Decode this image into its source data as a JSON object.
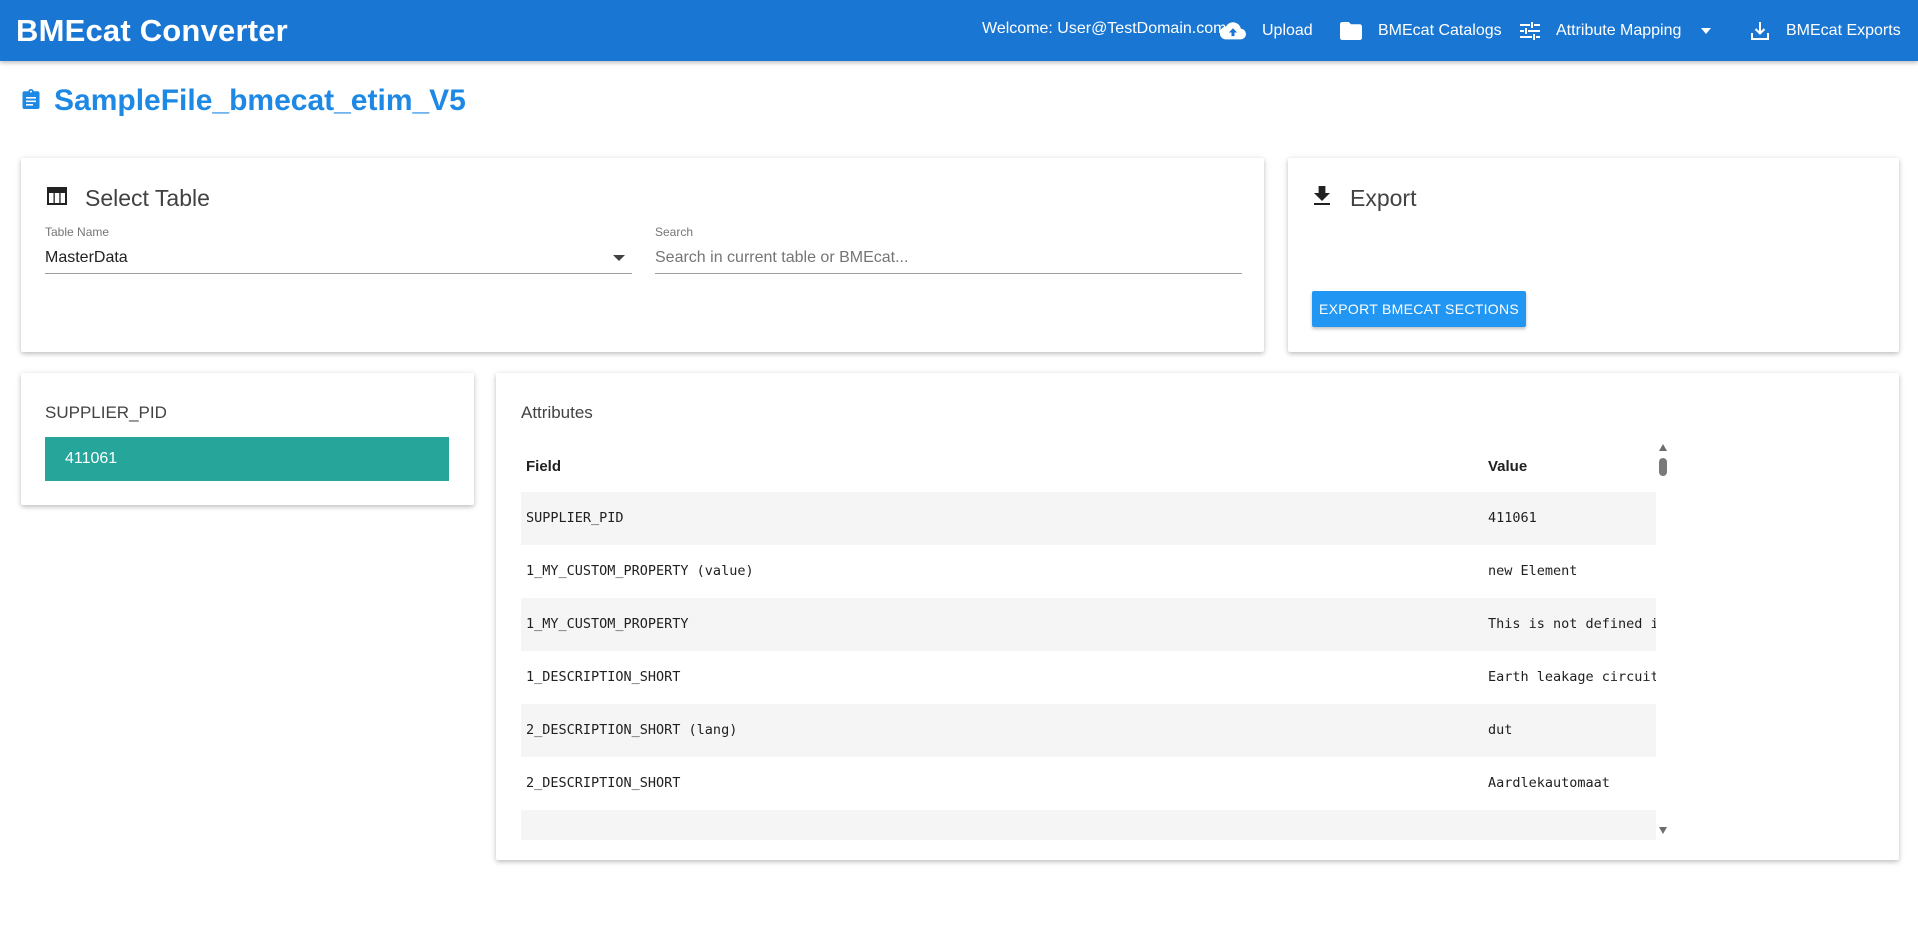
{
  "app": {
    "title": "BMEcat Converter",
    "accent": "#1976d2"
  },
  "header": {
    "welcome": "Welcome: User@TestDomain.com",
    "nav": {
      "upload": {
        "label": "Upload",
        "icon": "cloud-upload-icon"
      },
      "catalogs": {
        "label": "BMEcat Catalogs",
        "icon": "folder-icon"
      },
      "mapping": {
        "label": "Attribute Mapping",
        "icon": "tune-icon"
      },
      "exports": {
        "label": "BMEcat Exports",
        "icon": "download-tray-icon"
      }
    }
  },
  "page": {
    "title": "SampleFile_bmecat_etim_V5",
    "title_icon": "clipboard-icon",
    "title_color": "#1e88e5"
  },
  "select_table": {
    "heading": "Select Table",
    "icon": "table-icon",
    "table_name_label": "Table Name",
    "table_name_value": "MasterData",
    "search_label": "Search",
    "search_placeholder": "Search in current table or BMEcat..."
  },
  "export": {
    "heading": "Export",
    "icon": "download-icon",
    "button_label": "EXPORT BMECAT SECTIONS",
    "button_color": "#2196f3"
  },
  "supplier": {
    "heading": "SUPPLIER_PID",
    "selected": "411061",
    "selected_color": "#26a69a"
  },
  "attributes": {
    "heading": "Attributes",
    "columns": {
      "field": "Field",
      "value": "Value"
    },
    "rows": [
      {
        "field": "SUPPLIER_PID",
        "value": "411061"
      },
      {
        "field": "1_MY_CUSTOM_PROPERTY (value)",
        "value": "new Element"
      },
      {
        "field": "1_MY_CUSTOM_PROPERTY",
        "value": "This is not defined in BMEcat Standard"
      },
      {
        "field": "1_DESCRIPTION_SHORT",
        "value": "Earth leakage circuit breaker"
      },
      {
        "field": "2_DESCRIPTION_SHORT (lang)",
        "value": "dut"
      },
      {
        "field": "2_DESCRIPTION_SHORT",
        "value": "Aardlekautomaat"
      },
      {
        "field": "",
        "value": ""
      }
    ]
  }
}
